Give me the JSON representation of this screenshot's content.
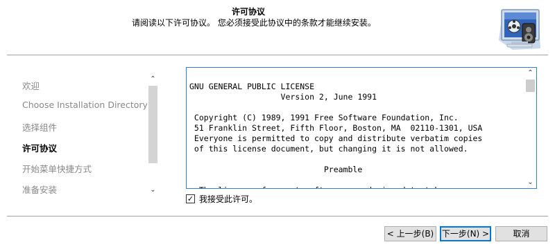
{
  "header": {
    "title": "许可协议",
    "subtitle": "请阅读以下许可协议。 您必须接受此协议中的条款才能继续安装。",
    "graphic_icon": "monitor-media-icon"
  },
  "steps": {
    "items": [
      {
        "label": "欢迎",
        "state": "done"
      },
      {
        "label": "Choose Installation Directory",
        "state": "done"
      },
      {
        "label": "选择组件",
        "state": "done"
      },
      {
        "label": "许可协议",
        "state": "current"
      },
      {
        "label": "开始菜单快捷方式",
        "state": "pending"
      },
      {
        "label": "准备安装",
        "state": "pending"
      }
    ]
  },
  "license": {
    "lines": [
      "GNU GENERAL PUBLIC LICENSE",
      "                   Version 2, June 1991",
      "",
      " Copyright (C) 1989, 1991 Free Software Foundation, Inc.",
      " 51 Franklin Street, Fifth Floor, Boston, MA  02110-1301, USA",
      " Everyone is permitted to copy and distribute verbatim copies",
      " of this license document, but changing it is not allowed.",
      "",
      "                            Preamble",
      "",
      "  The licenses for most software are designed to take away"
    ]
  },
  "accept": {
    "label": "我接受此许可。",
    "checked": true,
    "check_glyph": "✓"
  },
  "buttons": {
    "back": "< 上一步(B)",
    "next": "下一步(N) >",
    "cancel": "取消"
  },
  "colors": {
    "focus_border": "#2f7fd7",
    "button_bg": "#e1e1e1",
    "default_button_border": "#0078d7"
  }
}
